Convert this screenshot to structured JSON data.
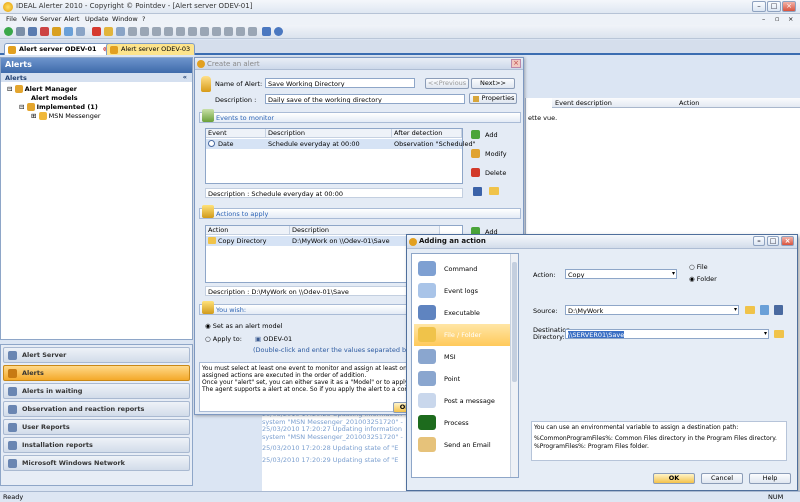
{
  "window": {
    "title": "IDEAL Alerter 2010 - Copyright © Pointdev - [Alert server ODEV-01]"
  },
  "menu": [
    "File",
    "View",
    "Server",
    "Alert",
    "Update",
    "Window",
    "?"
  ],
  "tabs": [
    "Alert server ODEV-01",
    "Alert server ODEV-03"
  ],
  "left": {
    "header": "Alerts",
    "section": "Alerts",
    "tree": {
      "root": "Alert Manager",
      "models": "Alert models",
      "implemented": "Implemented (1)",
      "item": "MSN Messenger"
    }
  },
  "nav": [
    "Alert Server",
    "Alerts",
    "Alerts in waiting",
    "Observation and reaction reports",
    "User Reports",
    "Installation reports",
    "Microsoft Windows Network"
  ],
  "grid": {
    "columns": [
      "Event description",
      "Action"
    ],
    "fragment": "ette vue."
  },
  "log": {
    "lines": [
      "25/03/2010 17:20:25 Updating information",
      "system \"MSN Messenger_201003251720\" -",
      "25/03/2010 17:20:27 Updating information",
      "system \"MSN Messenger_201003251720\" -",
      "25/03/2010 17:20:28 Updating state of \"E",
      "25/03/2010 17:20:29 Updating state of \"E"
    ]
  },
  "create": {
    "title": "Create an alert",
    "name_label": "Name of Alert:",
    "name_value": "Save Working Directory",
    "prev": "<<Previous",
    "next": "Next>>",
    "desc_label": "Description :",
    "desc_value": "Daily save of the working directory",
    "properties": "Properties",
    "events_section": "Events to monitor",
    "events_cols": [
      "Event",
      "Description",
      "After detection"
    ],
    "event_row": [
      "Date",
      "Schedule  everyday at 00:00",
      "Observation \"Scheduled\""
    ],
    "add": "Add",
    "modify": "Modify",
    "delete": "Delete",
    "event_desc": "Description : Schedule  everyday at 00:00",
    "actions_section": "Actions to apply",
    "actions_cols": [
      "Action",
      "Description"
    ],
    "action_row": [
      "Copy Directory",
      "D:\\MyWork on \\\\Odev-01\\Save"
    ],
    "add2": "Add",
    "action_desc": "Description : D:\\MyWork on \\\\Odev-01\\Save",
    "wish_section": "You wish:",
    "opt_model": "Set as an alert model",
    "opt_apply": "Apply to:",
    "apply_target": "ODEV-01",
    "apply_hint": "(Double-click and enter the values separated by \";\")",
    "info": [
      "You must select at least one event to monitor and assign at least one action. W",
      "assigned actions are executed in the order of addition.",
      "Once your \"alert\" set, you can either save it as a \"Model\" or to apply directly t",
      "The agent supports a alert at once. So if you apply the alert to a computer whe"
    ],
    "ok": "OK"
  },
  "adding": {
    "title": "Adding an action",
    "categories": [
      "Command",
      "Event logs",
      "Executable",
      "File / Folder",
      "MSI",
      "Point",
      "Post a message",
      "Process",
      "Send an Email"
    ],
    "action_label": "Action:",
    "action_value": "Copy",
    "opt_file": "File",
    "opt_folder": "Folder",
    "source_label": "Source:",
    "source_value": "D:\\MyWork",
    "dest_label": "Destination Directory:",
    "dest_value": "\\\\SERVER01\\Save",
    "help_text": [
      "You can use an environmental variable to assign a destination path:",
      "%CommonProgramFiles%: Common Files directory in the Program Files directory.",
      "%ProgramFiles%: Program Files folder."
    ],
    "ok": "OK",
    "cancel": "Cancel",
    "help": "Help"
  },
  "status": {
    "left": "Ready",
    "right": "NUM"
  }
}
